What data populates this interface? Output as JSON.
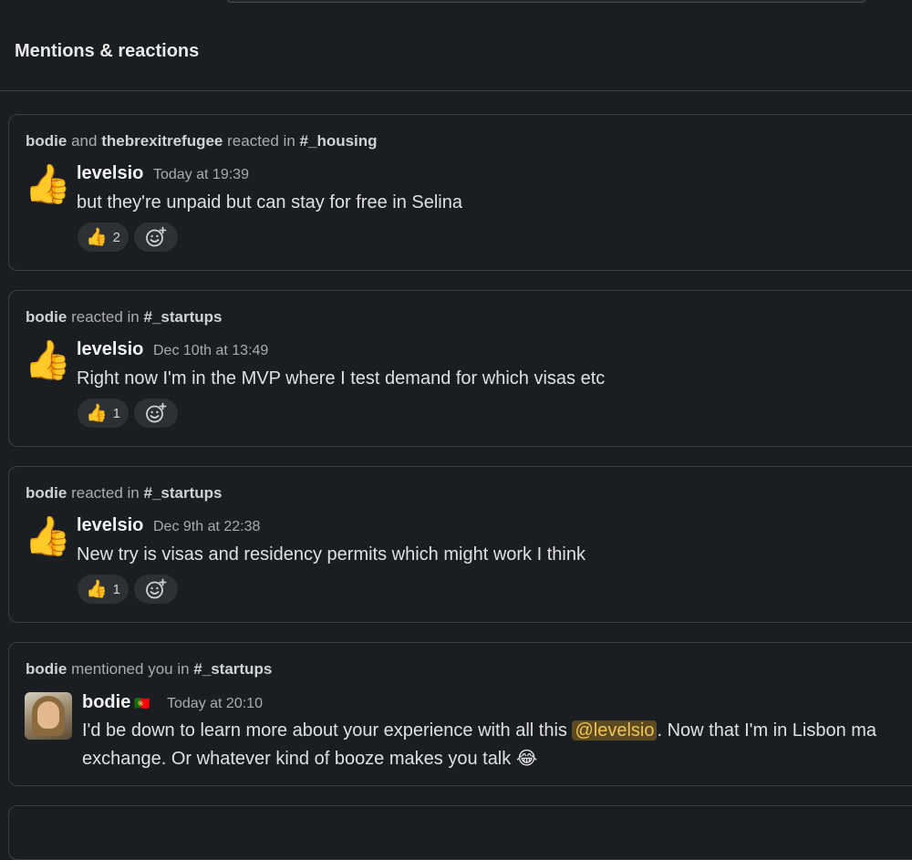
{
  "header": {
    "title": "Mentions & reactions"
  },
  "cards": [
    {
      "context": {
        "user1": "bodie",
        "and": "and",
        "user2": "thebrexitrefugee",
        "action": "reacted in",
        "channel": "#_housing"
      },
      "author": "levelsio",
      "timestamp": "Today at 19:39",
      "text": "but they're unpaid but can stay for free in Selina",
      "reaction": {
        "emoji": "👍",
        "count": "2"
      }
    },
    {
      "context": {
        "user1": "bodie",
        "action": "reacted in",
        "channel": "#_startups"
      },
      "author": "levelsio",
      "timestamp": "Dec 10th at 13:49",
      "text": "Right now I'm in the MVP where I test demand for which visas etc",
      "reaction": {
        "emoji": "👍",
        "count": "1"
      }
    },
    {
      "context": {
        "user1": "bodie",
        "action": "reacted in",
        "channel": "#_startups"
      },
      "author": "levelsio",
      "timestamp": "Dec 9th at 22:38",
      "text": "New try is visas and residency permits which might work I think",
      "reaction": {
        "emoji": "👍",
        "count": "1"
      }
    },
    {
      "context": {
        "user1": "bodie",
        "action": "mentioned you in",
        "channel": "#_startups"
      },
      "author": "bodie",
      "flag": "🇵🇹",
      "timestamp": "Today at 20:10",
      "text_before": "I'd be down to learn more about your experience with all this ",
      "mention": "@levelsio",
      "text_after": ". Now that I'm in Lisbon ma",
      "text_line2": "exchange. Or whatever kind of booze makes you talk ",
      "emoji_end": "😂"
    }
  ],
  "icons": {
    "reacted_emoji": "👍",
    "add_reaction": "add-reaction-icon"
  },
  "colors": {
    "background": "#1a1d21",
    "mention_bg": "#5c4a21",
    "mention_text": "#f0c35a"
  }
}
